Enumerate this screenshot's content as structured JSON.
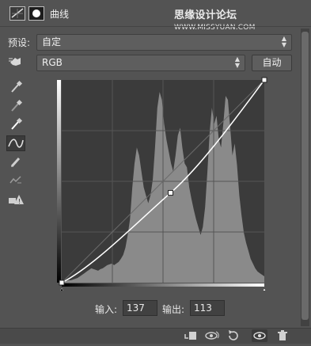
{
  "header": {
    "title": "曲线",
    "watermark_cn": "思缘设计论坛",
    "watermark_url": "WWW.MISSYUAN.COM"
  },
  "preset": {
    "label": "预设:",
    "value": "自定"
  },
  "channel": {
    "value": "RGB",
    "auto_label": "自动"
  },
  "tools": [
    {
      "name": "target-adjust-icon"
    },
    {
      "name": "black-eyedropper-icon"
    },
    {
      "name": "gray-eyedropper-icon"
    },
    {
      "name": "white-eyedropper-icon"
    },
    {
      "name": "curve-edit-icon"
    },
    {
      "name": "pencil-icon"
    },
    {
      "name": "smooth-icon"
    },
    {
      "name": "clipping-warning-icon"
    }
  ],
  "curve": {
    "input_label": "输入:",
    "input_value": "137",
    "output_label": "输出:",
    "output_value": "113",
    "points": [
      [
        0,
        0
      ],
      [
        137,
        113
      ],
      [
        255,
        255
      ]
    ]
  },
  "histogram": {
    "values": [
      2,
      2,
      2,
      3,
      3,
      4,
      5,
      6,
      8,
      10,
      12,
      14,
      16,
      18,
      17,
      16,
      15,
      17,
      18,
      20,
      22,
      23,
      24,
      22,
      24,
      26,
      30,
      35,
      44,
      60,
      80,
      120,
      150,
      170,
      160,
      140,
      120,
      110,
      100,
      110,
      130,
      170,
      220,
      240,
      230,
      200,
      180,
      165,
      150,
      140,
      160,
      185,
      195,
      170,
      150,
      145,
      120,
      105,
      92,
      80,
      70,
      60,
      70,
      95,
      140,
      190,
      220,
      200,
      210,
      180,
      170,
      200,
      235,
      230,
      195,
      160,
      175,
      148,
      110,
      85,
      63,
      50,
      40,
      30,
      24,
      18,
      14,
      12,
      10,
      8
    ],
    "max": 255
  },
  "colors": {
    "panel_bg": "#535353",
    "graph_bg": "#3b3b3b",
    "histogram": "#8a8a8a",
    "curve": "#ffffff"
  }
}
